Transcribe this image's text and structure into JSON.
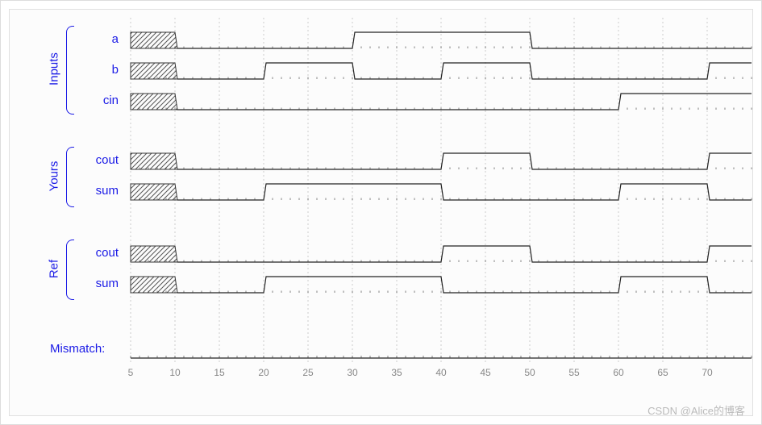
{
  "chart_data": {
    "type": "timing-diagram",
    "time_range": [
      5,
      75
    ],
    "ticks": [
      5,
      10,
      15,
      20,
      25,
      30,
      35,
      40,
      45,
      50,
      55,
      60,
      65,
      70
    ],
    "unknown_until": 10,
    "groups": [
      {
        "name": "Inputs",
        "signals": [
          {
            "name": "a",
            "transitions": [
              [
                10,
                0
              ],
              [
                30,
                1
              ],
              [
                50,
                0
              ]
            ]
          },
          {
            "name": "b",
            "transitions": [
              [
                10,
                0
              ],
              [
                20,
                1
              ],
              [
                30,
                0
              ],
              [
                40,
                1
              ],
              [
                50,
                0
              ],
              [
                70,
                1
              ]
            ]
          },
          {
            "name": "cin",
            "transitions": [
              [
                10,
                0
              ],
              [
                60,
                1
              ]
            ]
          }
        ]
      },
      {
        "name": "Yours",
        "signals": [
          {
            "name": "cout",
            "transitions": [
              [
                10,
                0
              ],
              [
                40,
                1
              ],
              [
                50,
                0
              ],
              [
                70,
                1
              ]
            ]
          },
          {
            "name": "sum",
            "transitions": [
              [
                10,
                0
              ],
              [
                20,
                1
              ],
              [
                40,
                0
              ],
              [
                60,
                1
              ],
              [
                70,
                0
              ]
            ]
          }
        ]
      },
      {
        "name": "Ref",
        "signals": [
          {
            "name": "cout",
            "transitions": [
              [
                10,
                0
              ],
              [
                40,
                1
              ],
              [
                50,
                0
              ],
              [
                70,
                1
              ]
            ]
          },
          {
            "name": "sum",
            "transitions": [
              [
                10,
                0
              ],
              [
                20,
                1
              ],
              [
                40,
                0
              ],
              [
                60,
                1
              ],
              [
                70,
                0
              ]
            ]
          }
        ]
      }
    ],
    "mismatch_label": "Mismatch:"
  },
  "watermark": "CSDN @Alice的博客"
}
